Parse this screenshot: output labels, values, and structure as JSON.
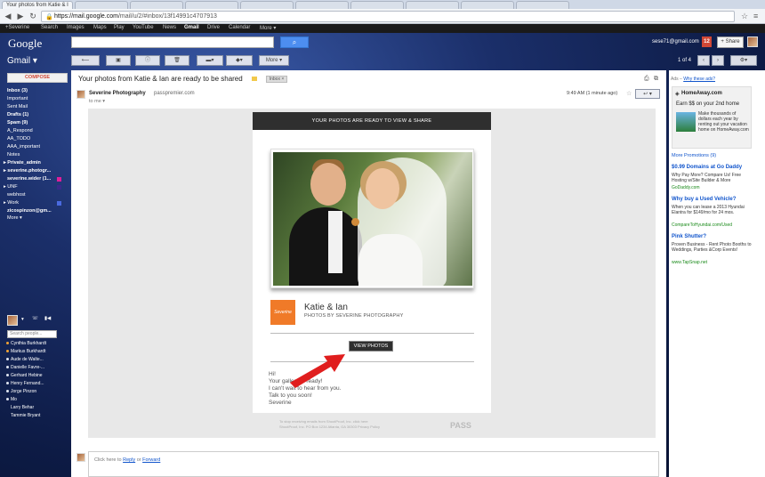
{
  "browser": {
    "active_tab_title": "Your photos from Katie & I",
    "url_host": "https://mail.google.com",
    "url_path": "/mail/u/2/#inbox/13f14991c4707913"
  },
  "gbar": {
    "items": [
      "+Severine",
      "Search",
      "Images",
      "Maps",
      "Play",
      "YouTube",
      "News",
      "Gmail",
      "Drive",
      "Calendar",
      "More ▾"
    ],
    "active": "Gmail"
  },
  "header": {
    "logo": "Google",
    "account": "sese71@gmail.com",
    "notifications": "12",
    "share_label": "+ Share"
  },
  "toolbar": {
    "app_label": "Gmail ▾",
    "more_label": "More ▾",
    "pager": "1 of 4"
  },
  "sidebar": {
    "compose_label": "COMPOSE",
    "items": [
      {
        "label": "Inbox (3)",
        "bold": true
      },
      {
        "label": "Important",
        "bold": false
      },
      {
        "label": "Sent Mail",
        "bold": false
      },
      {
        "label": "Drafts (1)",
        "bold": true
      },
      {
        "label": "Spam (9)",
        "bold": true
      },
      {
        "label": "A_Respond",
        "bold": false
      },
      {
        "label": "AA_TODO",
        "bold": false
      },
      {
        "label": "AAA_important",
        "bold": false
      },
      {
        "label": "Notes",
        "bold": false
      },
      {
        "label": "▸ Private_admin",
        "bold": true
      },
      {
        "label": "▸ severine.photogr...",
        "bold": true
      },
      {
        "label": "severine.wider (1...",
        "bold": true
      },
      {
        "label": "▸ UNF",
        "bold": false
      },
      {
        "label": "webhost",
        "bold": false
      },
      {
        "label": "▸ Work",
        "bold": false
      },
      {
        "label": "zicospinzon@gm...",
        "bold": true
      },
      {
        "label": "More ▾",
        "bold": false
      }
    ],
    "chat_search_placeholder": "Search people...",
    "contacts": [
      "Cynthia Burkhardt",
      "Markus Burkhardt",
      "Aude de Walte...",
      "Danielle Favre-...",
      "Gerhard Hebine",
      "Henry Fernand...",
      "Jorge Pinzon",
      "Mo",
      "Larry Behar",
      "Tammie Bryant"
    ]
  },
  "message": {
    "subject": "Your photos from Katie & Ian are ready to be shared",
    "label_chip": "Inbox ×",
    "sender_name": "Severine Photography",
    "sender_domain": "passpremier.com",
    "to": "to me ▾",
    "time": "9:49 AM (1 minute ago)",
    "email": {
      "header": "YOUR PHOTOS ARE READY TO VIEW & SHARE",
      "logo_text": "Severine",
      "gallery_title": "Katie & Ian",
      "gallery_subtitle": "PHOTOS BY SEVERINE PHOTOGRAPHY",
      "button": "VIEW PHOTOS",
      "body_lines": [
        "Hi!",
        "Your gallery is ready!",
        "I can't wait to hear from you.",
        "Talk to you soon!",
        "Severine"
      ],
      "footer_lines": [
        "To stop receiving emails from ShootProof, Inc. click here",
        "ShootProof, Inc. PO Box 1234 Atlanta, GA 30303 Privacy Policy"
      ],
      "footer_brand": "PASS"
    },
    "reply_prefix": "Click here to ",
    "reply_link": "Reply",
    "reply_mid": " or ",
    "forward_link": "Forward"
  },
  "ads": {
    "label": "Ads – ",
    "label_link": "Why these ads?",
    "promo": {
      "brand": "HomeAway.com",
      "title": "Earn $$ on your 2nd home",
      "text": "Make thousands of dollars each year by renting out your vacation home on HomeAway.com"
    },
    "more_promotions": "More Promotions (9)",
    "list": [
      {
        "title": "$0.99 Domains at Go Daddy",
        "desc": "Why Pay More? Compare Us! Free Hosting w/Site Builder & More",
        "url": "GoDaddy.com"
      },
      {
        "title": "Why buy a Used Vehicle?",
        "desc": "When you can lease a 2013 Hyundai Elantra for $149/mo for 24 mos.",
        "url": "CompareToHyundai.com/Used"
      },
      {
        "title": "Pink Shutter?",
        "desc": "Proven Business - Rent Photo Booths to Weddings, Parties &Corp Events!",
        "url": "www.TapSnap.net"
      }
    ]
  },
  "colors": {
    "compose_red": "#d14836",
    "search_blue": "#4d8ef0",
    "link_blue": "#1155cc",
    "brand_orange": "#f07a28",
    "arrow_red": "#e01e1e"
  }
}
